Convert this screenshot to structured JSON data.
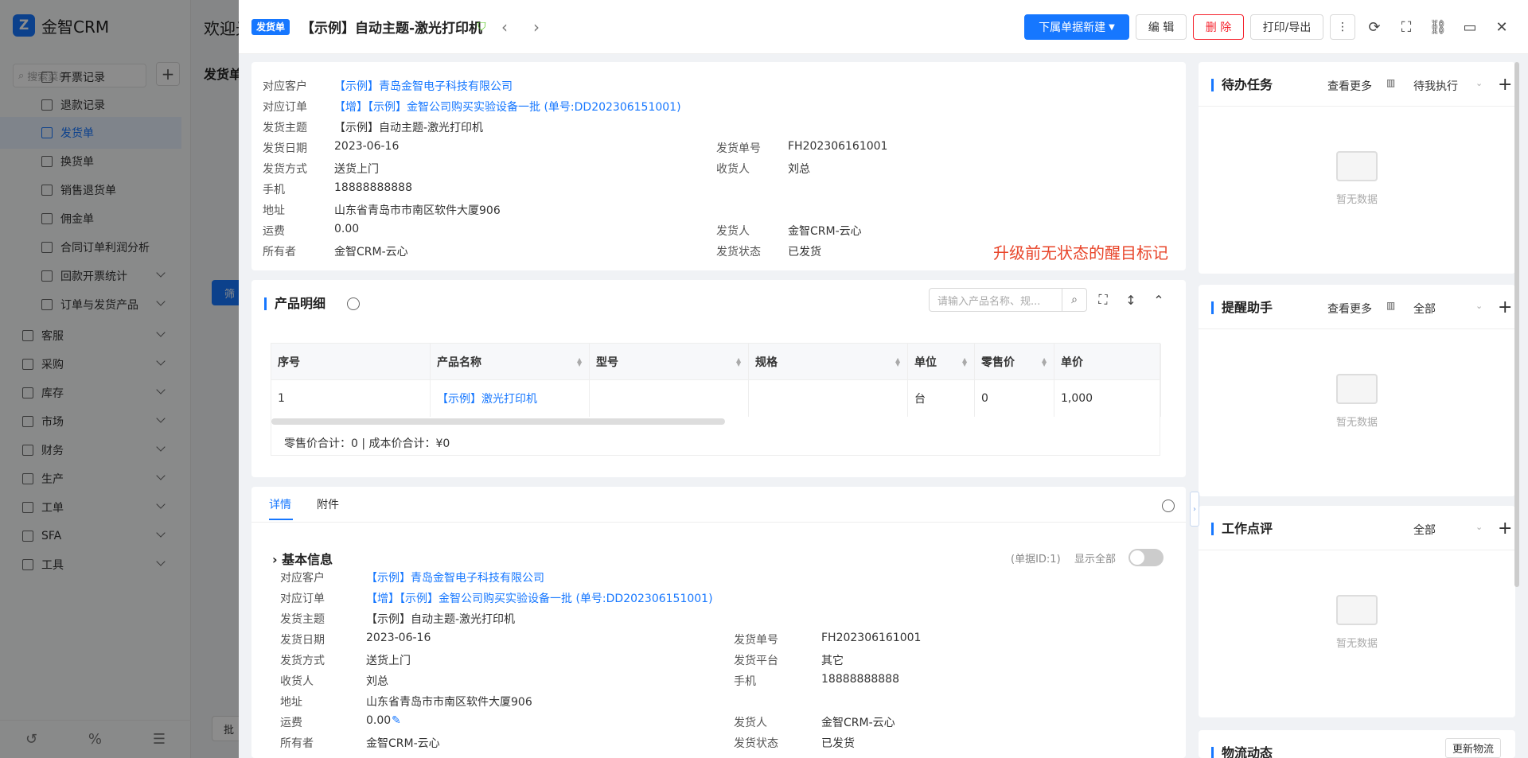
{
  "app": {
    "name": "金智CRM",
    "logo_letter": "Z"
  },
  "left_nav": {
    "search_placeholder": "搜索菜单",
    "items": [
      {
        "label": "开票记录",
        "type": "sub"
      },
      {
        "label": "退款记录",
        "type": "sub"
      },
      {
        "label": "发货单",
        "type": "sub",
        "active": true
      },
      {
        "label": "换货单",
        "type": "sub"
      },
      {
        "label": "销售退货单",
        "type": "sub"
      },
      {
        "label": "佣金单",
        "type": "sub"
      },
      {
        "label": "合同订单利润分析",
        "type": "sub"
      },
      {
        "label": "回款开票统计",
        "type": "sub",
        "chevron": true
      },
      {
        "label": "订单与发货产品",
        "type": "sub",
        "chevron": true
      },
      {
        "label": "客服",
        "type": "top",
        "chevron": true
      },
      {
        "label": "采购",
        "type": "top",
        "chevron": true
      },
      {
        "label": "库存",
        "type": "top",
        "chevron": true
      },
      {
        "label": "市场",
        "type": "top",
        "chevron": true
      },
      {
        "label": "财务",
        "type": "top",
        "chevron": true
      },
      {
        "label": "生产",
        "type": "top",
        "chevron": true
      },
      {
        "label": "工单",
        "type": "top",
        "chevron": true
      },
      {
        "label": "SFA",
        "type": "top",
        "chevron": true
      },
      {
        "label": "工具",
        "type": "top",
        "chevron": true
      }
    ],
    "bottom_icons": [
      "history-icon",
      "percent-icon",
      "sliders-icon"
    ]
  },
  "bg": {
    "welcome": "欢迎光",
    "tab": "发货单",
    "filter": "筛",
    "batch": "批"
  },
  "drawer": {
    "badge": "发货单",
    "title": "【示例】自动主题-激光打印机",
    "buttons": {
      "new_sub": "下属单据新建",
      "edit": "编 辑",
      "delete": "删 除",
      "print": "打印/导出"
    },
    "summary": [
      {
        "label": "对应客户",
        "value": "【示例】青岛金智电子科技有限公司",
        "link": true
      },
      {
        "label": "对应订单",
        "value": "【增】【示例】金智公司购买实验设备一批 (单号:DD202306151001)",
        "link": true
      },
      {
        "label": "发货主题",
        "value": "【示例】自动主题-激光打印机"
      },
      {
        "label": "发货日期",
        "value": "2023-06-16"
      },
      {
        "label": "发货方式",
        "value": "送货上门"
      },
      {
        "label": "手机",
        "value": "18888888888"
      },
      {
        "label": "地址",
        "value": "山东省青岛市市南区软件大厦906"
      },
      {
        "label": "运费",
        "value": "0.00"
      },
      {
        "label": "所有者",
        "value": "金智CRM-云心"
      }
    ],
    "summary_right": [
      {
        "label": "发货单号",
        "value": "FH202306161001"
      },
      {
        "label": "收货人",
        "value": "刘总"
      },
      {
        "label": "发货人",
        "value": "金智CRM-云心"
      },
      {
        "label": "发货状态",
        "value": "已发货"
      }
    ],
    "red_note": "升级前无状态的醒目标记",
    "products": {
      "title": "产品明细",
      "search_placeholder": "请输入产品名称、规...",
      "columns": [
        "序号",
        "产品名称",
        "型号",
        "规格",
        "单位",
        "零售价",
        "单价"
      ],
      "rows": [
        [
          "1",
          "【示例】激光打印机",
          "",
          "",
          "台",
          "0",
          "1,000"
        ]
      ],
      "totals": "零售价合计：0 |   成本价合计：¥0"
    },
    "detail_tabs": [
      "详情",
      "附件"
    ],
    "basic": {
      "title": "基本信息",
      "doc_id": "(单据ID:1)",
      "show_all": "显示全部",
      "left": [
        {
          "label": "对应客户",
          "value": "【示例】青岛金智电子科技有限公司",
          "link": true
        },
        {
          "label": "对应订单",
          "value": "【增】【示例】金智公司购买实验设备一批 (单号:DD202306151001)",
          "link": true
        },
        {
          "label": "发货主题",
          "value": "【示例】自动主题-激光打印机"
        },
        {
          "label": "发货日期",
          "value": "2023-06-16"
        },
        {
          "label": "发货方式",
          "value": "送货上门"
        },
        {
          "label": "收货人",
          "value": "刘总"
        },
        {
          "label": "地址",
          "value": "山东省青岛市市南区软件大厦906"
        },
        {
          "label": "运费",
          "value": "0.00"
        },
        {
          "label": "所有者",
          "value": "金智CRM-云心"
        }
      ],
      "right": [
        {
          "label": "发货单号",
          "value": "FH202306161001"
        },
        {
          "label": "发货平台",
          "value": "其它"
        },
        {
          "label": "手机",
          "value": "18888888888"
        },
        {
          "label": "发货人",
          "value": "金智CRM-云心"
        },
        {
          "label": "发货状态",
          "value": "已发货"
        }
      ]
    },
    "side": [
      {
        "title": "待办任务",
        "more": "查看更多",
        "filter": "待我执行",
        "empty": "暂无数据"
      },
      {
        "title": "提醒助手",
        "more": "查看更多",
        "filter": "全部",
        "empty": "暂无数据"
      },
      {
        "title": "工作点评",
        "more": "",
        "filter": "全部",
        "empty": "暂无数据"
      },
      {
        "title": "物流动态",
        "more": "",
        "filter": "更新物流",
        "empty": ""
      }
    ]
  }
}
